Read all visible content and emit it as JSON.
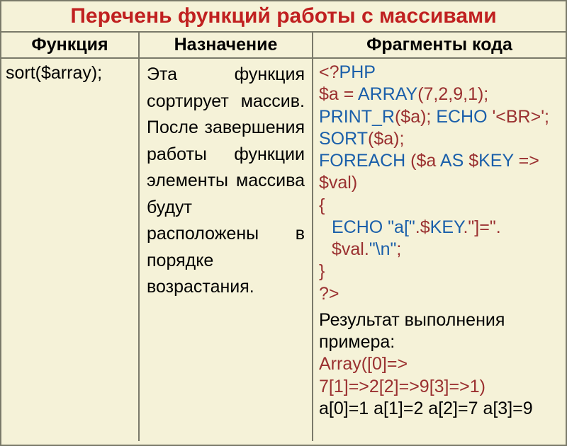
{
  "title": "Перечень функций работы с массивами",
  "headers": {
    "col1": "Функция",
    "col2": "Назначение",
    "col3": "Фрагменты кода"
  },
  "row": {
    "function_name": "sort($array);",
    "description": "Эта функция сортирует массив. После завершения работы функции элементы массива будут расположены в порядке возрастания.",
    "code": {
      "open_php": "<?",
      "php_kw": "PHP",
      "line1_assign": "$a = ",
      "array_fn": "ARRAY",
      "array_args": "(7,2,9,1);",
      "print_r": "PRINT_R",
      "print_r_args": "($a); ",
      "echo1": "ECHO",
      "echo1_str": " '<BR>'",
      "semi1": ";",
      "sort_fn": "SORT",
      "sort_args": "($a);",
      "foreach_kw": "FOREACH",
      "foreach_parens": " ($a ",
      "as_kw": "AS",
      "key_var": " $",
      "key_kw": "KEY",
      "arrow": " => ",
      "val_var": "$val)",
      "brace_open": "{",
      "echo2": "ECHO",
      "echo2_str1": " \"a[\"",
      "dot1": ".$",
      "key_kw2": "KEY",
      "dot2": ".\"]=\"",
      "dot3": ". $val.",
      "nl_str": "\"\\n\"",
      "semi2": ";",
      "brace_close": "}",
      "close_php": "?>"
    },
    "result_label": "Результат выполнения примера:",
    "result_array": "Array([0]=> 7[1]=>2[2]=>9[3]=>1)",
    "result_lines": "a[0]=1 a[1]=2 a[2]=7 a[3]=9"
  }
}
